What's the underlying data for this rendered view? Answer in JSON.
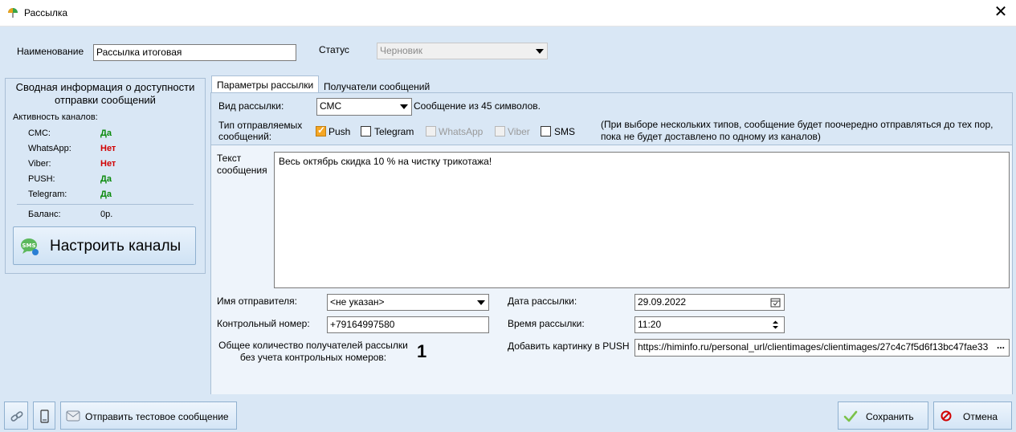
{
  "window": {
    "title": "Рассылка",
    "close_glyph": "✕"
  },
  "header": {
    "name_label": "Наименование",
    "name_value": "Рассылка итоговая",
    "status_label": "Статус",
    "status_value": "Черновик"
  },
  "summary": {
    "title": "Сводная информация о доступности отправки сообщений",
    "activity_label": "Активность каналов:",
    "channels": [
      {
        "name": "СМС:",
        "state": "Да"
      },
      {
        "name": "WhatsApp:",
        "state": "Нет"
      },
      {
        "name": "Viber:",
        "state": "Нет"
      },
      {
        "name": "PUSH:",
        "state": "Да"
      },
      {
        "name": "Telegram:",
        "state": "Да"
      }
    ],
    "balance_label": "Баланс:",
    "balance_value": "0р.",
    "configure_button": "Настроить каналы",
    "configure_icon_text": "SMS"
  },
  "tabs": [
    {
      "label": "Параметры рассылки",
      "active": true
    },
    {
      "label": "Получатели сообщений",
      "active": false
    }
  ],
  "params": {
    "type_label": "Вид рассылки:",
    "type_value": "СМС",
    "type_info": "Сообщение из 45 символов.",
    "msg_types_label": "Тип отправляемых сообщений:",
    "msg_types": [
      {
        "label": "Push",
        "checked": true,
        "enabled": true
      },
      {
        "label": "Telegram",
        "checked": false,
        "enabled": true
      },
      {
        "label": "WhatsApp",
        "checked": false,
        "enabled": false
      },
      {
        "label": "Viber",
        "checked": false,
        "enabled": false
      },
      {
        "label": "SMS",
        "checked": false,
        "enabled": true
      }
    ],
    "note": "(При выборе нескольких типов, сообщение будет поочередно отправляться до тех пор, пока не будет доставлено по одному из каналов)",
    "text_label": "Текст сообщения",
    "text_value": "Весь октябрь скидка 10 % на чистку трикотажа!",
    "sender_label": "Имя отправителя:",
    "sender_value": "<не указан>",
    "control_label": "Контрольный номер:",
    "control_value": "+79164997580",
    "recipients_label": "Общее количество получателей рассылки без учета контрольных номеров:",
    "recipients_count": "1",
    "date_label": "Дата рассылки:",
    "date_value": "29.09.2022",
    "time_label": "Время рассылки:",
    "time_value": "11:20",
    "image_label": "Добавить картинку в PUSH",
    "image_value": "https://himinfo.ru/personal_url/clientimages/clientimages/27c4c7f5d6f13bc47fae33",
    "image_browse": "..."
  },
  "footer": {
    "test_button": "Отправить тестовое сообщение",
    "save_button": "Сохранить",
    "cancel_button": "Отмена"
  },
  "colors": {
    "yes": "#0a8a0a",
    "no": "#d10000",
    "background": "#d9e7f5"
  }
}
